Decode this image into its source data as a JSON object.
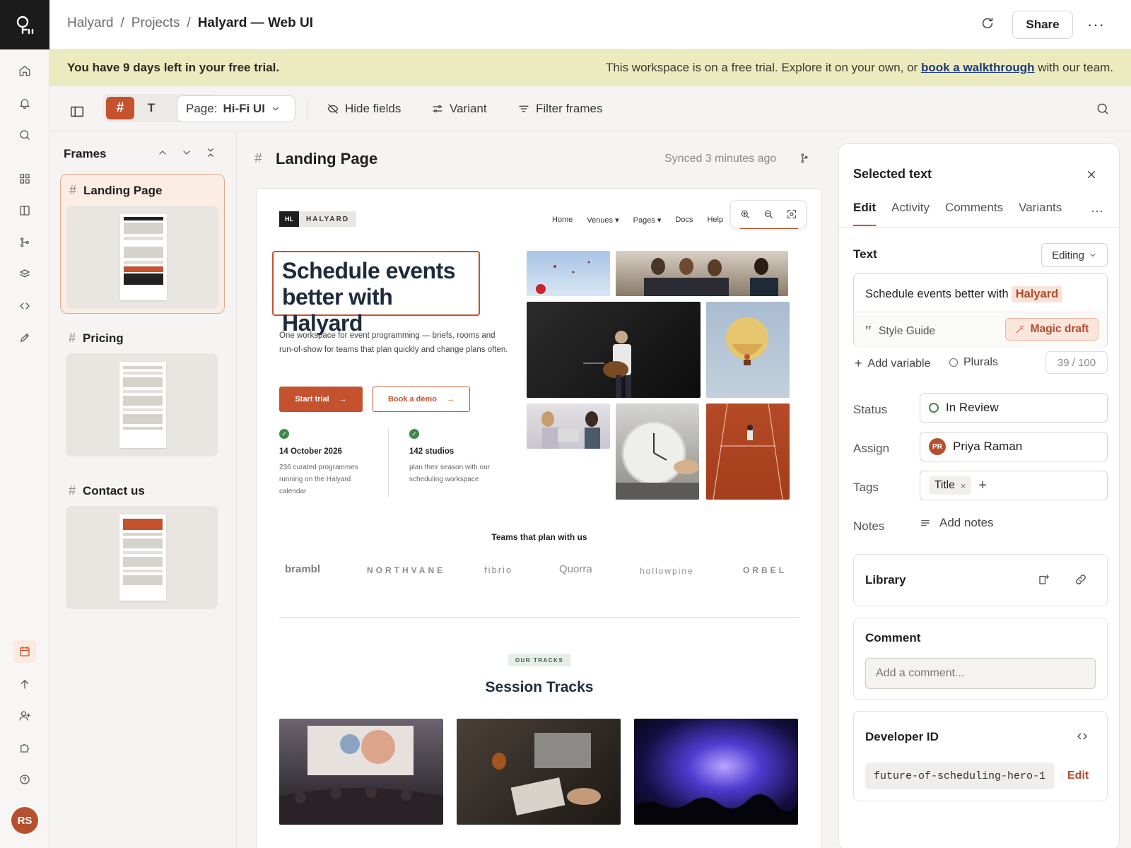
{
  "breadcrumb": [
    "Halyard",
    "Projects",
    "Halyard — Web UI"
  ],
  "header": {
    "share_label": "Share",
    "more_label": "···"
  },
  "trial": {
    "left": "You have 9 days left in your free trial.",
    "right_pre": "This workspace is on a free trial. Explore it on your own, or ",
    "link": "book a walkthrough",
    "right_post": " with our team."
  },
  "user": {
    "initials": "RS"
  },
  "toolbar": {
    "mode_frame": "#",
    "mode_text": "T",
    "page_label": "Page:",
    "page_value": "Hi-Fi UI",
    "hide_fields": "Hide fields",
    "variant": "Variant",
    "filter_frames": "Filter frames"
  },
  "frames_panel": {
    "title": "Frames",
    "items": [
      {
        "name": "Landing Page"
      },
      {
        "name": "Pricing"
      },
      {
        "name": "Contact us"
      }
    ]
  },
  "canvas": {
    "frame_title": "Landing Page",
    "sync_status": "Synced 3 minutes ago",
    "site": {
      "logo_mark": "HL",
      "logo_word": "HALYARD",
      "nav": [
        "Home",
        "Venues ▾",
        "Pages ▾",
        "Docs",
        "Help"
      ],
      "hero_title": "Schedule events better with Halyard",
      "hero_desc": "One workspace for event programming — briefs, rooms and run-of-show for teams that plan quickly and change plans often.",
      "start_trial": "Start trial",
      "book_demo": "Book a demo",
      "arrow": "→",
      "stats": [
        {
          "heading": "14 October 2026",
          "body": "236 curated programmes running on the Halyard calendar"
        },
        {
          "heading": "142 studios",
          "body": "plan their season with our scheduling workspace"
        }
      ],
      "teams_title": "Teams that plan with us",
      "brands": [
        "brambl",
        "NORTHVANE",
        "fibrio",
        "Quorra",
        "hollowpine",
        "ORBEL"
      ],
      "tracks_badge": "OUR TRACKS",
      "tracks_title": "Session Tracks"
    }
  },
  "inspector": {
    "title": "Selected text",
    "tabs": [
      "Edit",
      "Activity",
      "Comments",
      "Variants"
    ],
    "text_label": "Text",
    "editing_label": "Editing",
    "text_value_pre": "Schedule events better with",
    "text_value_var": "Halyard",
    "style_guide": "Style Guide",
    "magic_draft": "Magic draft",
    "add_variable": "Add variable",
    "plurals": "Plurals",
    "char_count": "39 / 100",
    "status_label": "Status",
    "status_value": "In Review",
    "assign_label": "Assign",
    "assignee_initials": "PR",
    "assignee_name": "Priya Raman",
    "tags_label": "Tags",
    "tag": "Title",
    "notes_label": "Notes",
    "add_notes": "Add notes",
    "library_title": "Library",
    "comment_title": "Comment",
    "comment_placeholder": "Add a comment...",
    "dev_title": "Developer ID",
    "dev_id": "future-of-scheduling-hero-1",
    "dev_edit": "Edit"
  }
}
